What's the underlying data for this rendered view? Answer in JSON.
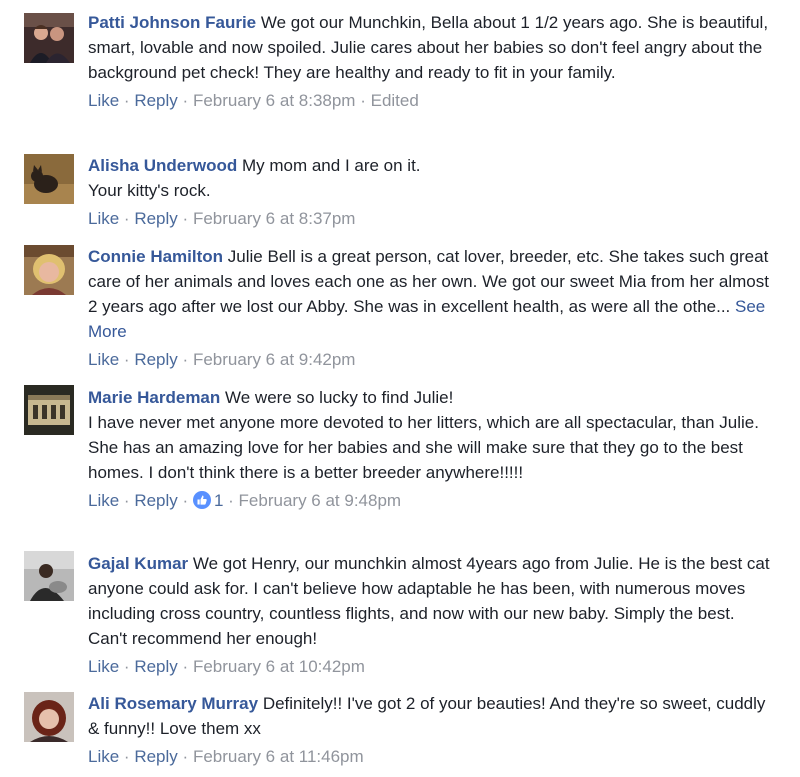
{
  "comments": [
    {
      "author": "Patti Johnson Faurie",
      "avatar_icon": "profile-photo-couple",
      "text": "We got our Munchkin, Bella about 1 1/2 years ago. She is beautiful, smart, lovable and now spoiled. Julie cares about her babies so don't feel angry about the background pet check! They are healthy and ready to fit in your family.",
      "like_label": "Like",
      "reply_label": "Reply",
      "timestamp": "February 6 at 8:38pm",
      "edited_label": "Edited"
    },
    {
      "author": "Alisha Underwood",
      "avatar_icon": "profile-photo-cat",
      "text_lines": [
        "My mom and I are on it.",
        "Your kitty's rock."
      ],
      "like_label": "Like",
      "reply_label": "Reply",
      "timestamp": "February 6 at 8:37pm"
    },
    {
      "author": "Connie Hamilton",
      "avatar_icon": "profile-photo-woman",
      "text": "Julie Bell is a great person, cat lover, breeder, etc. She takes such great care of her animals and loves each one as her own. We got our sweet Mia from her almost 2 years ago after we lost our Abby. She was in excellent health, as were all the othe...",
      "see_more_label": "See More",
      "like_label": "Like",
      "reply_label": "Reply",
      "timestamp": "February 6 at 9:42pm"
    },
    {
      "author": "Marie Hardeman",
      "avatar_icon": "profile-photo-building",
      "text_lines": [
        "We were so lucky to find Julie!",
        "I have never met anyone more devoted to her litters, which are all spectacular, than Julie.",
        "She has an amazing love for her babies and she will make sure that they go to the best homes. I don't think there is a better breeder anywhere!!!!!"
      ],
      "like_label": "Like",
      "reply_label": "Reply",
      "reaction_icon": "thumbs-up-icon",
      "reaction_count": "1",
      "timestamp": "February 6 at 9:48pm"
    },
    {
      "author": "Gajal Kumar",
      "avatar_icon": "profile-photo-person-cat",
      "text": "We got Henry, our munchkin almost 4years ago from Julie. He is the best cat anyone could ask for. I can't believe how adaptable he has been, with numerous moves including cross country, countless flights, and now with our new baby. Simply the best. Can't recommend her enough!",
      "like_label": "Like",
      "reply_label": "Reply",
      "timestamp": "February 6 at 10:42pm"
    },
    {
      "author": "Ali Rosemary Murray",
      "avatar_icon": "profile-photo-woman-red-hair",
      "text": "Definitely!! I've got 2 of your beauties! And they're so sweet, cuddly & funny!! Love them xx",
      "like_label": "Like",
      "reply_label": "Reply",
      "timestamp": "February 6 at 11:46pm"
    }
  ],
  "separator": "·",
  "colors": {
    "author_link": "#365899",
    "action_link": "#4b6a9b",
    "meta_text": "#90949c",
    "body_text": "#1d2129",
    "like_badge": "#5890ff"
  }
}
